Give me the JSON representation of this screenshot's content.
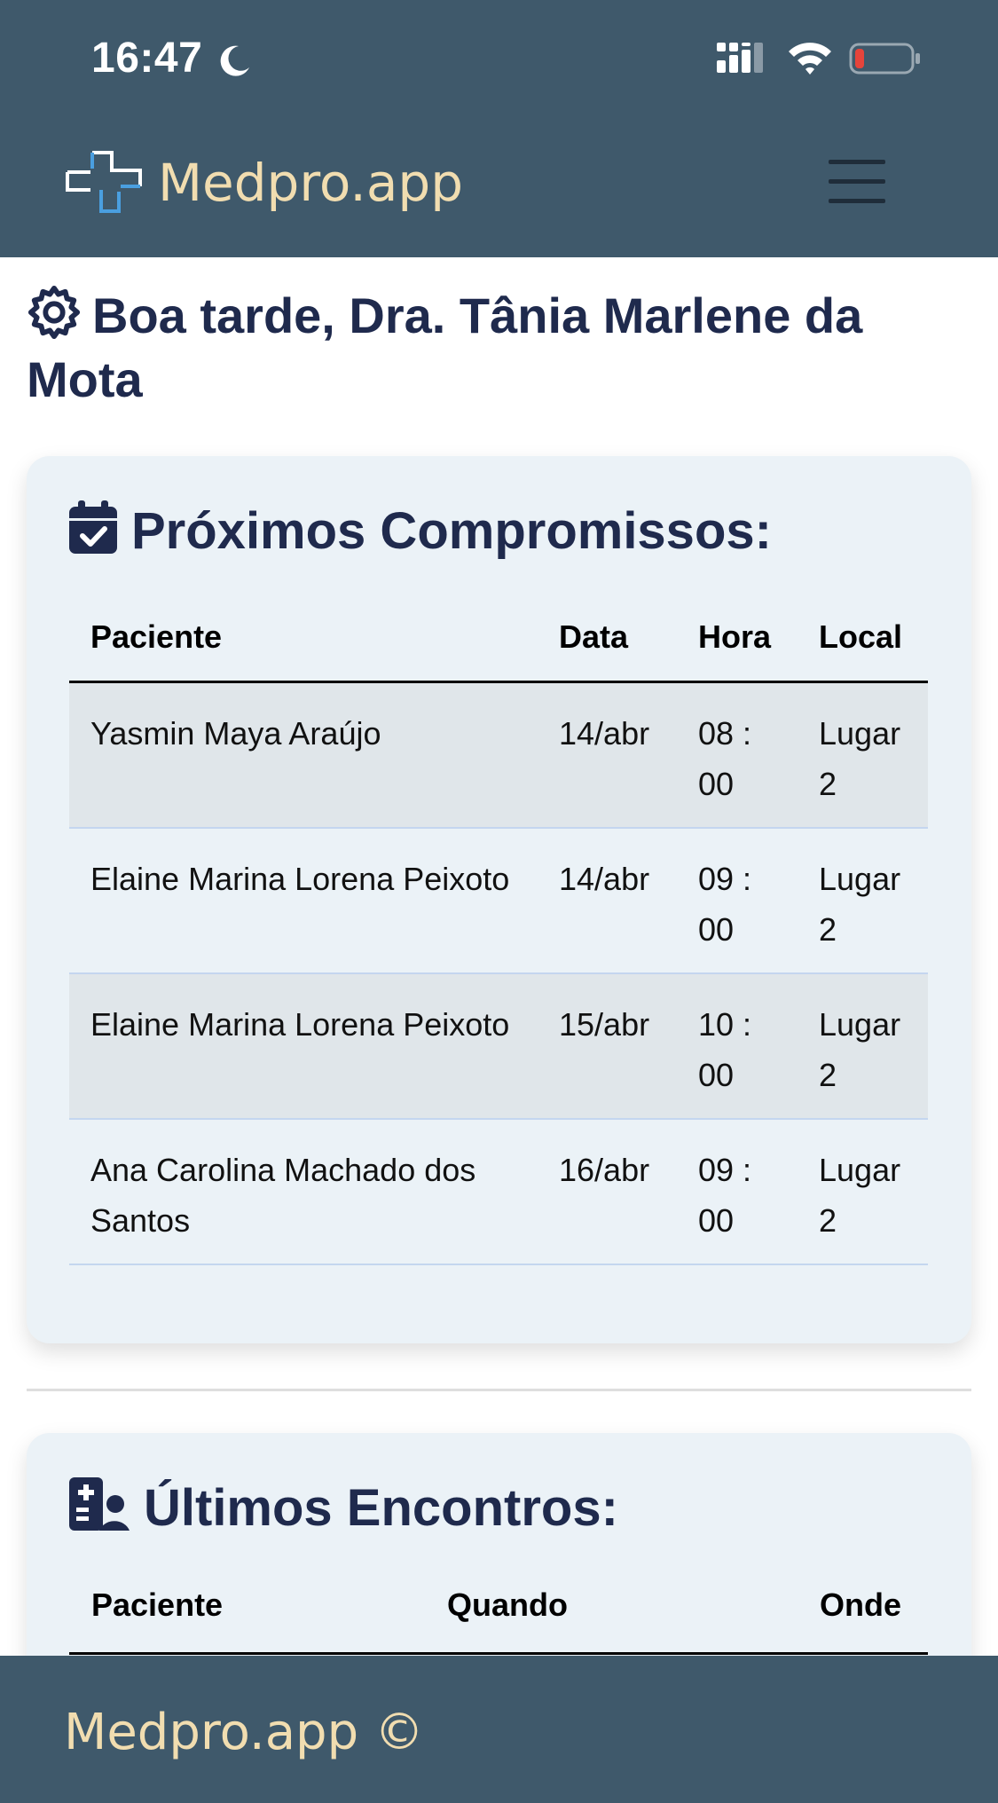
{
  "status_bar": {
    "time": "16:47"
  },
  "navbar": {
    "brand": "Medpro.app"
  },
  "greeting": "Boa tarde, Dra. Tânia Marlene da Mota",
  "upcoming": {
    "title": "Próximos Compromissos:",
    "headers": [
      "Paciente",
      "Data",
      "Hora",
      "Local"
    ],
    "rows": [
      {
        "patient": "Yasmin Maya Araújo",
        "date": "14/abr",
        "hour": "08 : 00",
        "place": "Lugar 2"
      },
      {
        "patient": "Elaine Marina Lorena Peixoto",
        "date": "14/abr",
        "hour": "09 : 00",
        "place": "Lugar 2"
      },
      {
        "patient": "Elaine Marina Lorena Peixoto",
        "date": "15/abr",
        "hour": "10 : 00",
        "place": "Lugar 2"
      },
      {
        "patient": "Ana Carolina Machado dos Santos",
        "date": "16/abr",
        "hour": "09 : 00",
        "place": "Lugar 2"
      }
    ]
  },
  "recent": {
    "title": "Últimos Encontros:",
    "headers": [
      "Paciente",
      "Quando",
      "Onde"
    ]
  },
  "footer": {
    "text": "Medpro.app ©"
  },
  "colors": {
    "navbar": "#3f596b",
    "brand_text": "#f1ddb0",
    "heading": "#1f2a4d",
    "card_bg": "#ebf2f7",
    "row_stripe": "#e0e6ea",
    "logo_white": "#ffffff",
    "logo_blue": "#4a9fe0",
    "battery_low": "#e5443b"
  },
  "icons": {
    "greeting": "gear-icon",
    "upcoming": "calendar-check-icon",
    "recent": "hospital-user-icon",
    "menu": "hamburger-icon"
  }
}
